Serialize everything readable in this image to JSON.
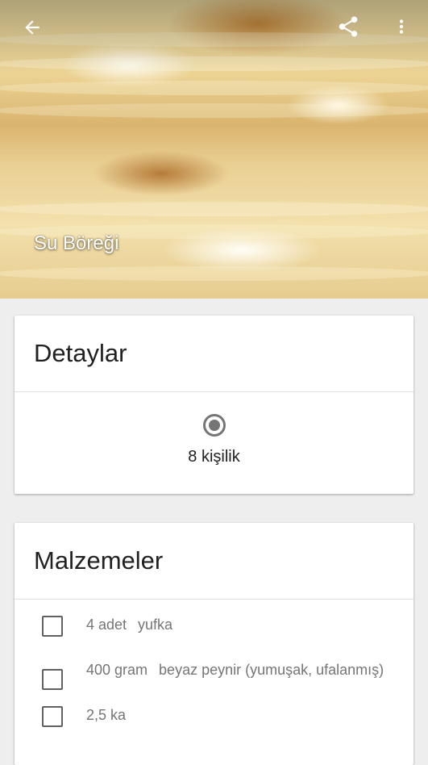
{
  "header": {
    "title": "Su Böreği",
    "back_icon": "arrow-back-icon",
    "share_icon": "share-icon",
    "more_icon": "more-vert-icon"
  },
  "details": {
    "title": "Detaylar",
    "servings_icon": "servings-radio-icon",
    "servings": "8 kişilik"
  },
  "ingredients": {
    "title": "Malzemeler",
    "items": [
      {
        "amount": "4 adet",
        "name": "yufka",
        "checked": false
      },
      {
        "amount": "400 gram",
        "name": "beyaz peynir (yumuşak, ufalanmış)",
        "checked": false
      },
      {
        "amount": "2,5 ka",
        "name": "",
        "checked": false
      }
    ]
  },
  "colors": {
    "background": "#eeeeee",
    "card": "#ffffff",
    "text_primary": "#212121",
    "text_secondary": "#757575"
  }
}
